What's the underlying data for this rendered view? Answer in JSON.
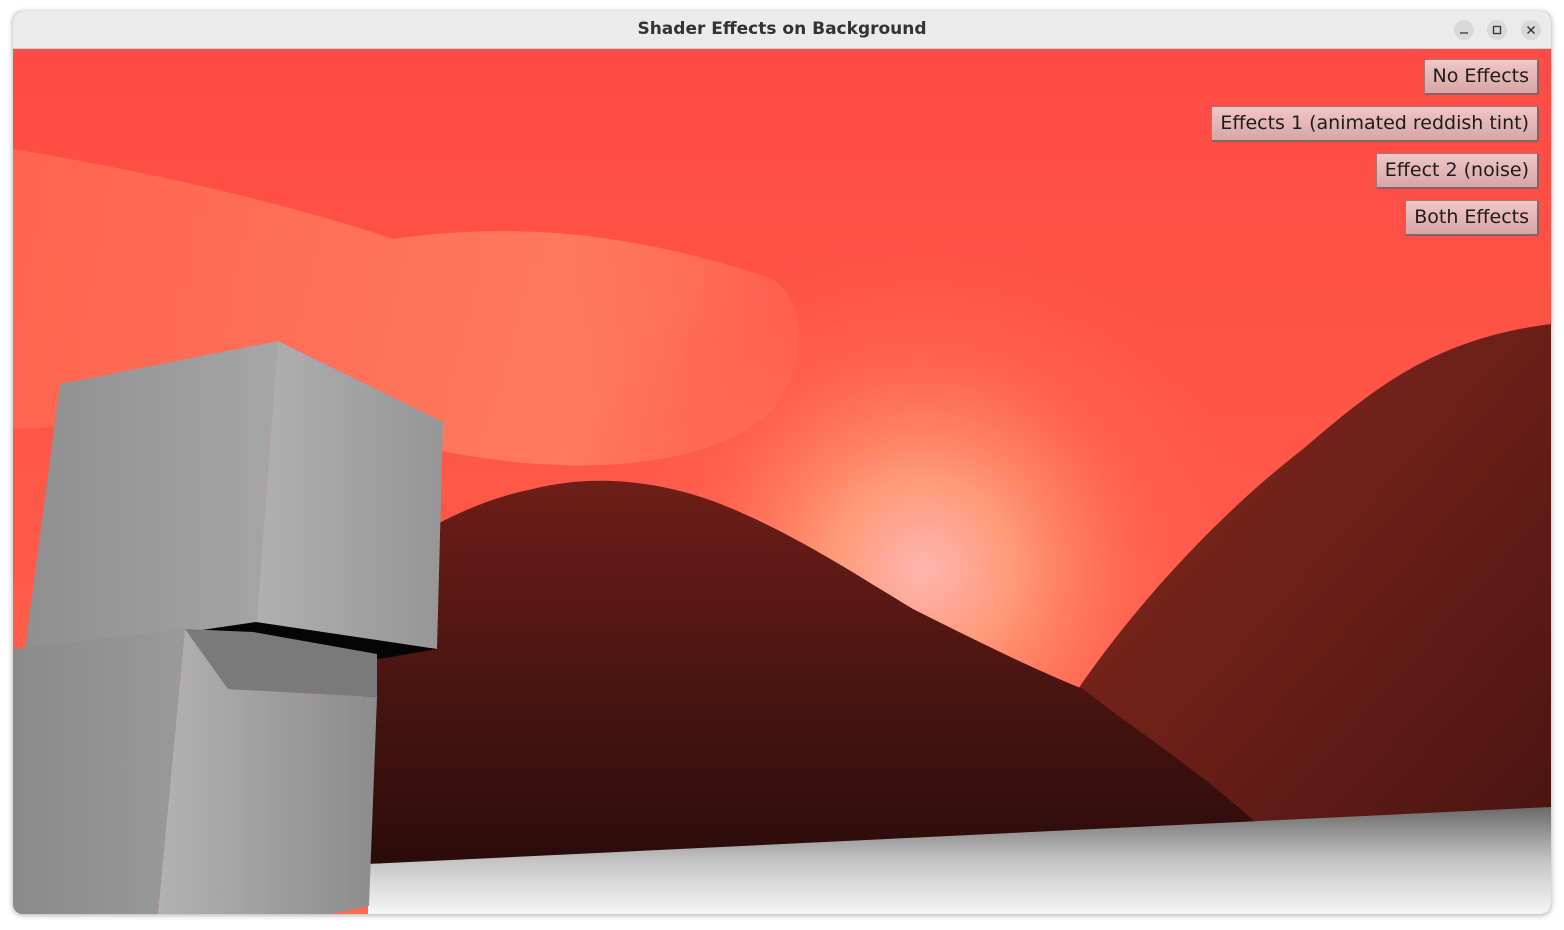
{
  "window": {
    "title": "Shader Effects on Background",
    "controls": [
      "minimize-icon",
      "maximize-icon",
      "close-icon"
    ]
  },
  "effect_buttons": [
    {
      "label": "No Effects"
    },
    {
      "label": "Effects 1 (animated reddish tint)"
    },
    {
      "label": "Effect 2 (noise)"
    },
    {
      "label": "Both Effects"
    }
  ],
  "colors": {
    "sky_top": "#ff4a44",
    "sky_glow": "#ffb08a",
    "mountain": "#5a1a16",
    "cube": "#a8a8a8",
    "button_bg": "#e2b6b6"
  }
}
